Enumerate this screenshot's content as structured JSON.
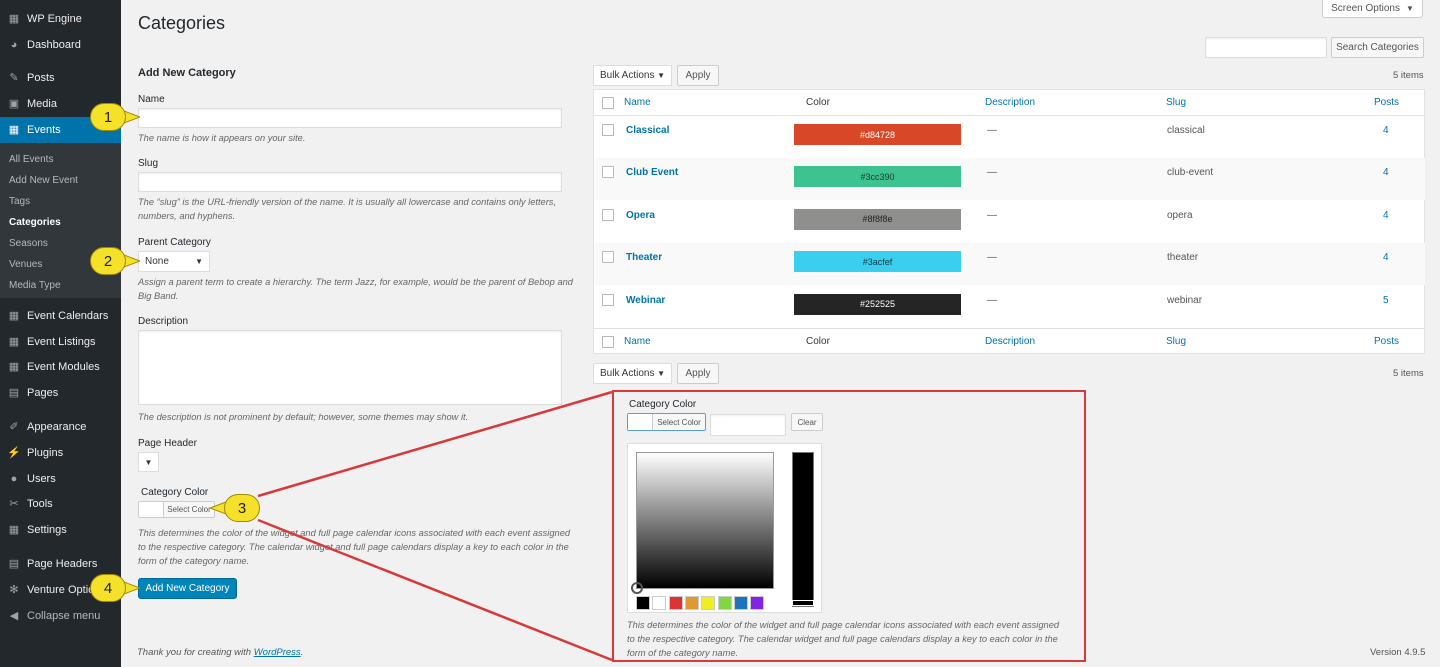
{
  "sidebar": {
    "items": [
      {
        "label": "WP Engine",
        "icon": "wp-engine-icon",
        "glyph": "▦"
      },
      {
        "label": "Dashboard",
        "icon": "dashboard-icon",
        "glyph": "◕"
      },
      {
        "label": "Posts",
        "icon": "pin-icon",
        "glyph": "✎"
      },
      {
        "label": "Media",
        "icon": "media-icon",
        "glyph": "▣"
      },
      {
        "label": "Events",
        "icon": "calendar-icon",
        "glyph": "▦"
      },
      {
        "label": "Event Calendars",
        "icon": "calendar-icon",
        "glyph": "▦"
      },
      {
        "label": "Event Listings",
        "icon": "calendar-icon",
        "glyph": "▦"
      },
      {
        "label": "Event Modules",
        "icon": "calendar-icon",
        "glyph": "▦"
      },
      {
        "label": "Pages",
        "icon": "pages-icon",
        "glyph": "▤"
      },
      {
        "label": "Appearance",
        "icon": "brush-icon",
        "glyph": "✐"
      },
      {
        "label": "Plugins",
        "icon": "plug-icon",
        "glyph": "⚡"
      },
      {
        "label": "Users",
        "icon": "user-icon",
        "glyph": "●"
      },
      {
        "label": "Tools",
        "icon": "wrench-icon",
        "glyph": "✂"
      },
      {
        "label": "Settings",
        "icon": "settings-icon",
        "glyph": "▦"
      },
      {
        "label": "Page Headers",
        "icon": "page-headers-icon",
        "glyph": "▤"
      },
      {
        "label": "Venture Options",
        "icon": "gear-icon",
        "glyph": "✻"
      },
      {
        "label": "Collapse menu",
        "icon": "collapse-icon",
        "glyph": "◀"
      }
    ],
    "sub_items": [
      "All Events",
      "Add New Event",
      "Tags",
      "Categories",
      "Seasons",
      "Venues",
      "Media Type"
    ]
  },
  "page": {
    "title": "Categories",
    "screen_options": "Screen Options",
    "search_button": "Search Categories",
    "search_value": ""
  },
  "form": {
    "heading": "Add New Category",
    "name_label": "Name",
    "name_value": "",
    "name_desc": "The name is how it appears on your site.",
    "slug_label": "Slug",
    "slug_value": "",
    "slug_desc_1": "The “slug” is the URL-friendly version of the name. It is usually all lowercase and contains only letters,",
    "slug_desc_2": "numbers, and hyphens.",
    "parent_label": "Parent Category",
    "parent_value": "None",
    "parent_desc_1": "Assign a parent term to create a hierarchy. The term Jazz, for example, would be the parent of Bebop",
    "parent_desc_2": "and",
    "parent_desc_3": "Big Band.",
    "description_label": "Description",
    "description_value": "",
    "description_desc": "The description is not prominent by default; however, some themes may show it.",
    "page_header_label": "Page Header",
    "page_header_value": "",
    "category_color_label": "Category Color",
    "select_color": "Select Color",
    "color_desc_1": "This determines the color of the widget and full page calendar icons associated with each event assigned",
    "color_desc_2": "to the respective category. The calendar widget and full page calendars display a key to each color in the",
    "color_desc_3": "form of the category name.",
    "submit": "Add New Category"
  },
  "callouts": [
    "1",
    "2",
    "3",
    "4"
  ],
  "list": {
    "bulk_actions": "Bulk Actions",
    "apply": "Apply",
    "count": "5 items",
    "columns": {
      "name": "Name",
      "color": "Color",
      "description": "Description",
      "slug": "Slug",
      "posts": "Posts"
    },
    "rows": [
      {
        "name": "Classical",
        "color": "#d84728",
        "text_color": "#ffffff",
        "description": "—",
        "slug": "classical",
        "posts": "4"
      },
      {
        "name": "Club Event",
        "color": "#3cc390",
        "text_color": "#1e3a2e",
        "description": "—",
        "slug": "club-event",
        "posts": "4"
      },
      {
        "name": "Opera",
        "color": "#8f8f8e",
        "text_color": "#222222",
        "description": "—",
        "slug": "opera",
        "posts": "4"
      },
      {
        "name": "Theater",
        "color": "#3acfef",
        "text_color": "#103844",
        "description": "—",
        "slug": "theater",
        "posts": "4"
      },
      {
        "name": "Webinar",
        "color": "#252525",
        "text_color": "#ffffff",
        "description": "—",
        "slug": "webinar",
        "posts": "5"
      }
    ]
  },
  "zoom": {
    "label": "Category Color",
    "select_color": "Select Color",
    "hex_value": "",
    "clear": "Clear",
    "presets": [
      "#000000",
      "#ffffff",
      "#dd3333",
      "#dd9933",
      "#eeee22",
      "#81d742",
      "#1e73be",
      "#8224e3"
    ],
    "desc_1": "This determines the color of the widget and full page calendar icons associated with each event assigned",
    "desc_2": "to the respective category. The calendar widget and full page calendars display a key to each color in the",
    "desc_3": "form of the category name."
  },
  "footer": {
    "thanks": "Thank you for creating with",
    "wp_link": "WordPress",
    "period": ".",
    "version": "Version 4.9.5"
  },
  "colors": {
    "accent": "#0073aa",
    "highlight": "#d63b3b",
    "callout": "#f5e12a",
    "sidebar": "#23282d"
  }
}
